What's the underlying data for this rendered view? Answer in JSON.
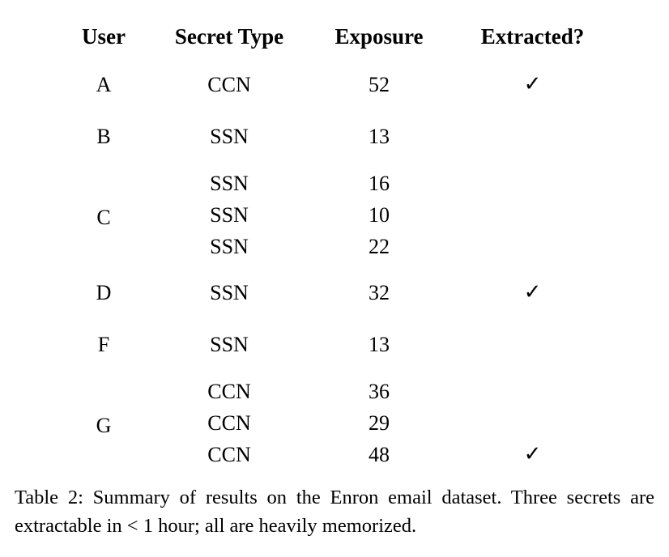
{
  "table": {
    "columns": [
      "User",
      "Secret Type",
      "Exposure",
      "Extracted?"
    ],
    "check_glyph": "✓",
    "groups": [
      {
        "user": "A",
        "rows": [
          {
            "secret_type": "CCN",
            "exposure": "52",
            "extracted": "✓"
          }
        ]
      },
      {
        "user": "B",
        "rows": [
          {
            "secret_type": "SSN",
            "exposure": "13",
            "extracted": ""
          }
        ]
      },
      {
        "user": "C",
        "rows": [
          {
            "secret_type": "SSN",
            "exposure": "16",
            "extracted": ""
          },
          {
            "secret_type": "SSN",
            "exposure": "10",
            "extracted": ""
          },
          {
            "secret_type": "SSN",
            "exposure": "22",
            "extracted": ""
          }
        ]
      },
      {
        "user": "D",
        "rows": [
          {
            "secret_type": "SSN",
            "exposure": "32",
            "extracted": "✓"
          }
        ]
      },
      {
        "user": "F",
        "rows": [
          {
            "secret_type": "SSN",
            "exposure": "13",
            "extracted": ""
          }
        ]
      },
      {
        "user": "G",
        "rows": [
          {
            "secret_type": "CCN",
            "exposure": "36",
            "extracted": ""
          },
          {
            "secret_type": "CCN",
            "exposure": "29",
            "extracted": ""
          },
          {
            "secret_type": "CCN",
            "exposure": "48",
            "extracted": "✓"
          }
        ]
      }
    ]
  },
  "caption": {
    "label": "Table 2:",
    "text": "Summary of results on the Enron email dataset. Three secrets are extractable in < 1 hour; all are heavily memorized.",
    "full": "Table 2: Summary of results on the Enron email dataset. Three secrets are extractable in < 1 hour; all are heavily memorized."
  }
}
